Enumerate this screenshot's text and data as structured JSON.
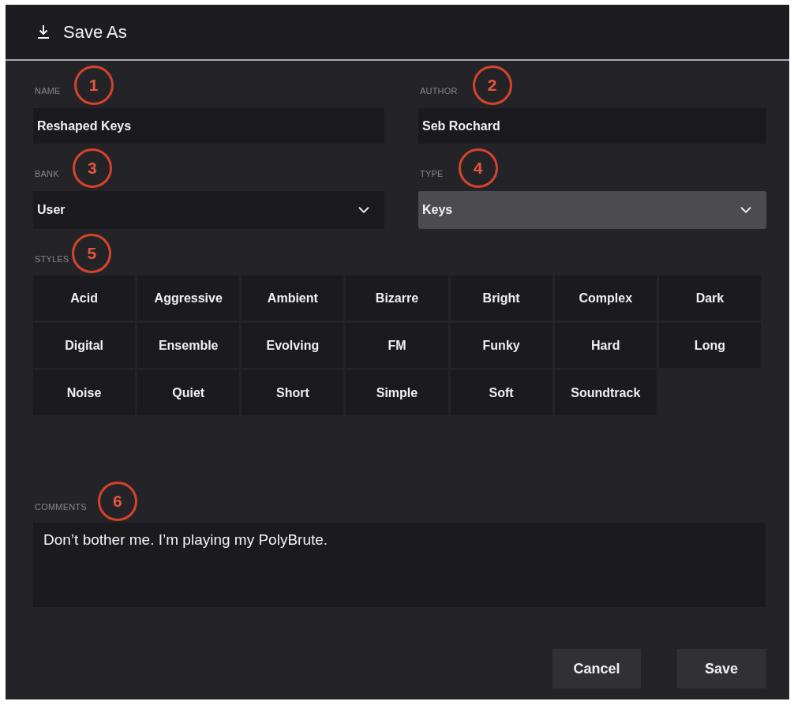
{
  "window": {
    "title": "Save As"
  },
  "fields": [
    {
      "kind": "text",
      "label": "NAME",
      "callout": "1",
      "value": "Reshaped Keys"
    },
    {
      "kind": "text",
      "label": "AUTHOR",
      "callout": "2",
      "value": "Seb Rochard"
    },
    {
      "kind": "dropdown",
      "label": "BANK",
      "callout": "3",
      "value": "User",
      "highlighted": false
    },
    {
      "kind": "dropdown",
      "label": "TYPE",
      "callout": "4",
      "value": "Keys",
      "highlighted": true
    }
  ],
  "styles": {
    "label": "STYLES",
    "callout": "5",
    "items": [
      {
        "label": "Acid",
        "selected": false
      },
      {
        "label": "Aggressive",
        "selected": false
      },
      {
        "label": "Ambient",
        "selected": false
      },
      {
        "label": "Bizarre",
        "selected": false
      },
      {
        "label": "Bright",
        "selected": false
      },
      {
        "label": "Complex",
        "selected": false
      },
      {
        "label": "Dark",
        "selected": false
      },
      {
        "label": "Digital",
        "selected": false
      },
      {
        "label": "Ensemble",
        "selected": false
      },
      {
        "label": "Evolving",
        "selected": false
      },
      {
        "label": "FM",
        "selected": false
      },
      {
        "label": "Funky",
        "selected": false
      },
      {
        "label": "Hard",
        "selected": false
      },
      {
        "label": "Long",
        "selected": false
      },
      {
        "label": "Noise",
        "selected": false
      },
      {
        "label": "Quiet",
        "selected": false
      },
      {
        "label": "Short",
        "selected": false
      },
      {
        "label": "Simple",
        "selected": false
      },
      {
        "label": "Soft",
        "selected": false
      },
      {
        "label": "Soundtrack",
        "selected": false
      }
    ]
  },
  "comments": {
    "label": "COMMENTS",
    "callout": "6",
    "value": "Don’t bother me. I’m playing my PolyBrute."
  },
  "buttons": [
    {
      "label": "Cancel"
    },
    {
      "label": "Save"
    }
  ]
}
